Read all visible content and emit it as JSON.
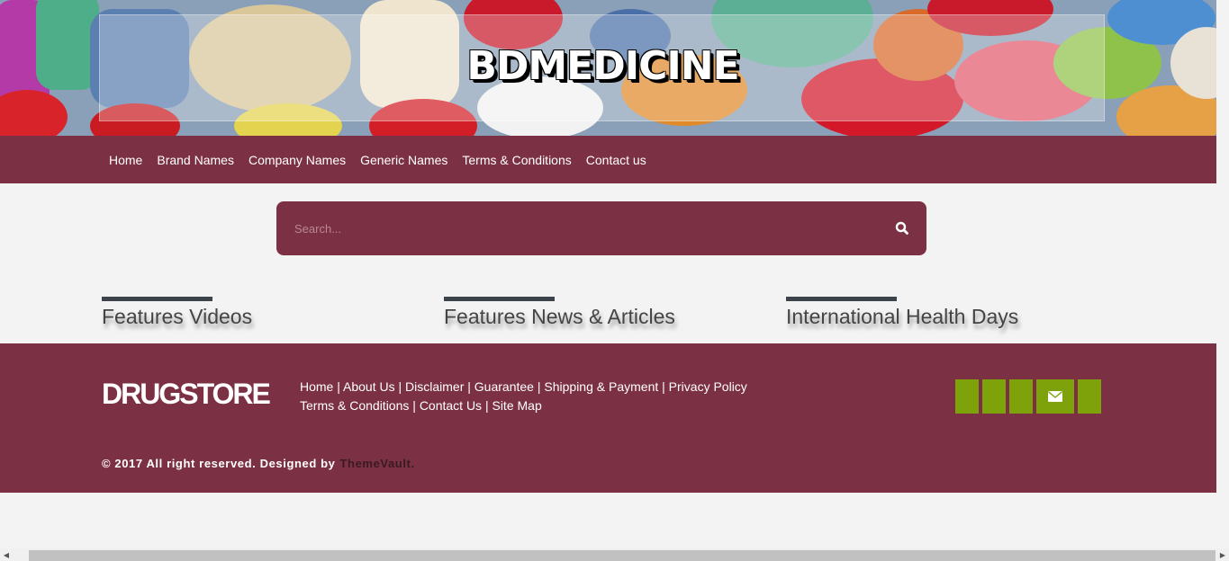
{
  "banner": {
    "title": "BDMEDICINE"
  },
  "nav": {
    "items": [
      {
        "label": "Home"
      },
      {
        "label": "Brand Names"
      },
      {
        "label": "Company Names"
      },
      {
        "label": "Generic Names"
      },
      {
        "label": "Terms & Conditions"
      },
      {
        "label": "Contact us"
      }
    ]
  },
  "search": {
    "placeholder": "Search...",
    "icon": "search-icon"
  },
  "features": [
    {
      "heading": "Features Videos"
    },
    {
      "heading": "Features News & Articles"
    },
    {
      "heading": "International Health Days"
    }
  ],
  "footer": {
    "logo": "DRUGSTORE",
    "links_row1": [
      "Home",
      "About Us",
      "Disclaimer",
      "Guarantee",
      "Shipping & Payment",
      "Privacy Policy"
    ],
    "links_row2": [
      "Terms & Conditions",
      "Contact Us",
      "Site Map"
    ],
    "separator": " | ",
    "social_icons": [
      "social-icon",
      "social-icon",
      "social-icon",
      "envelope-icon",
      "social-icon"
    ],
    "copyright": "© 2017 All right reserved. Designed by",
    "designer": "ThemeVault."
  },
  "colors": {
    "brand": "#7b3043",
    "social": "#7ea20a",
    "feature_bar": "#3d434a",
    "background": "#f3f3f3"
  }
}
